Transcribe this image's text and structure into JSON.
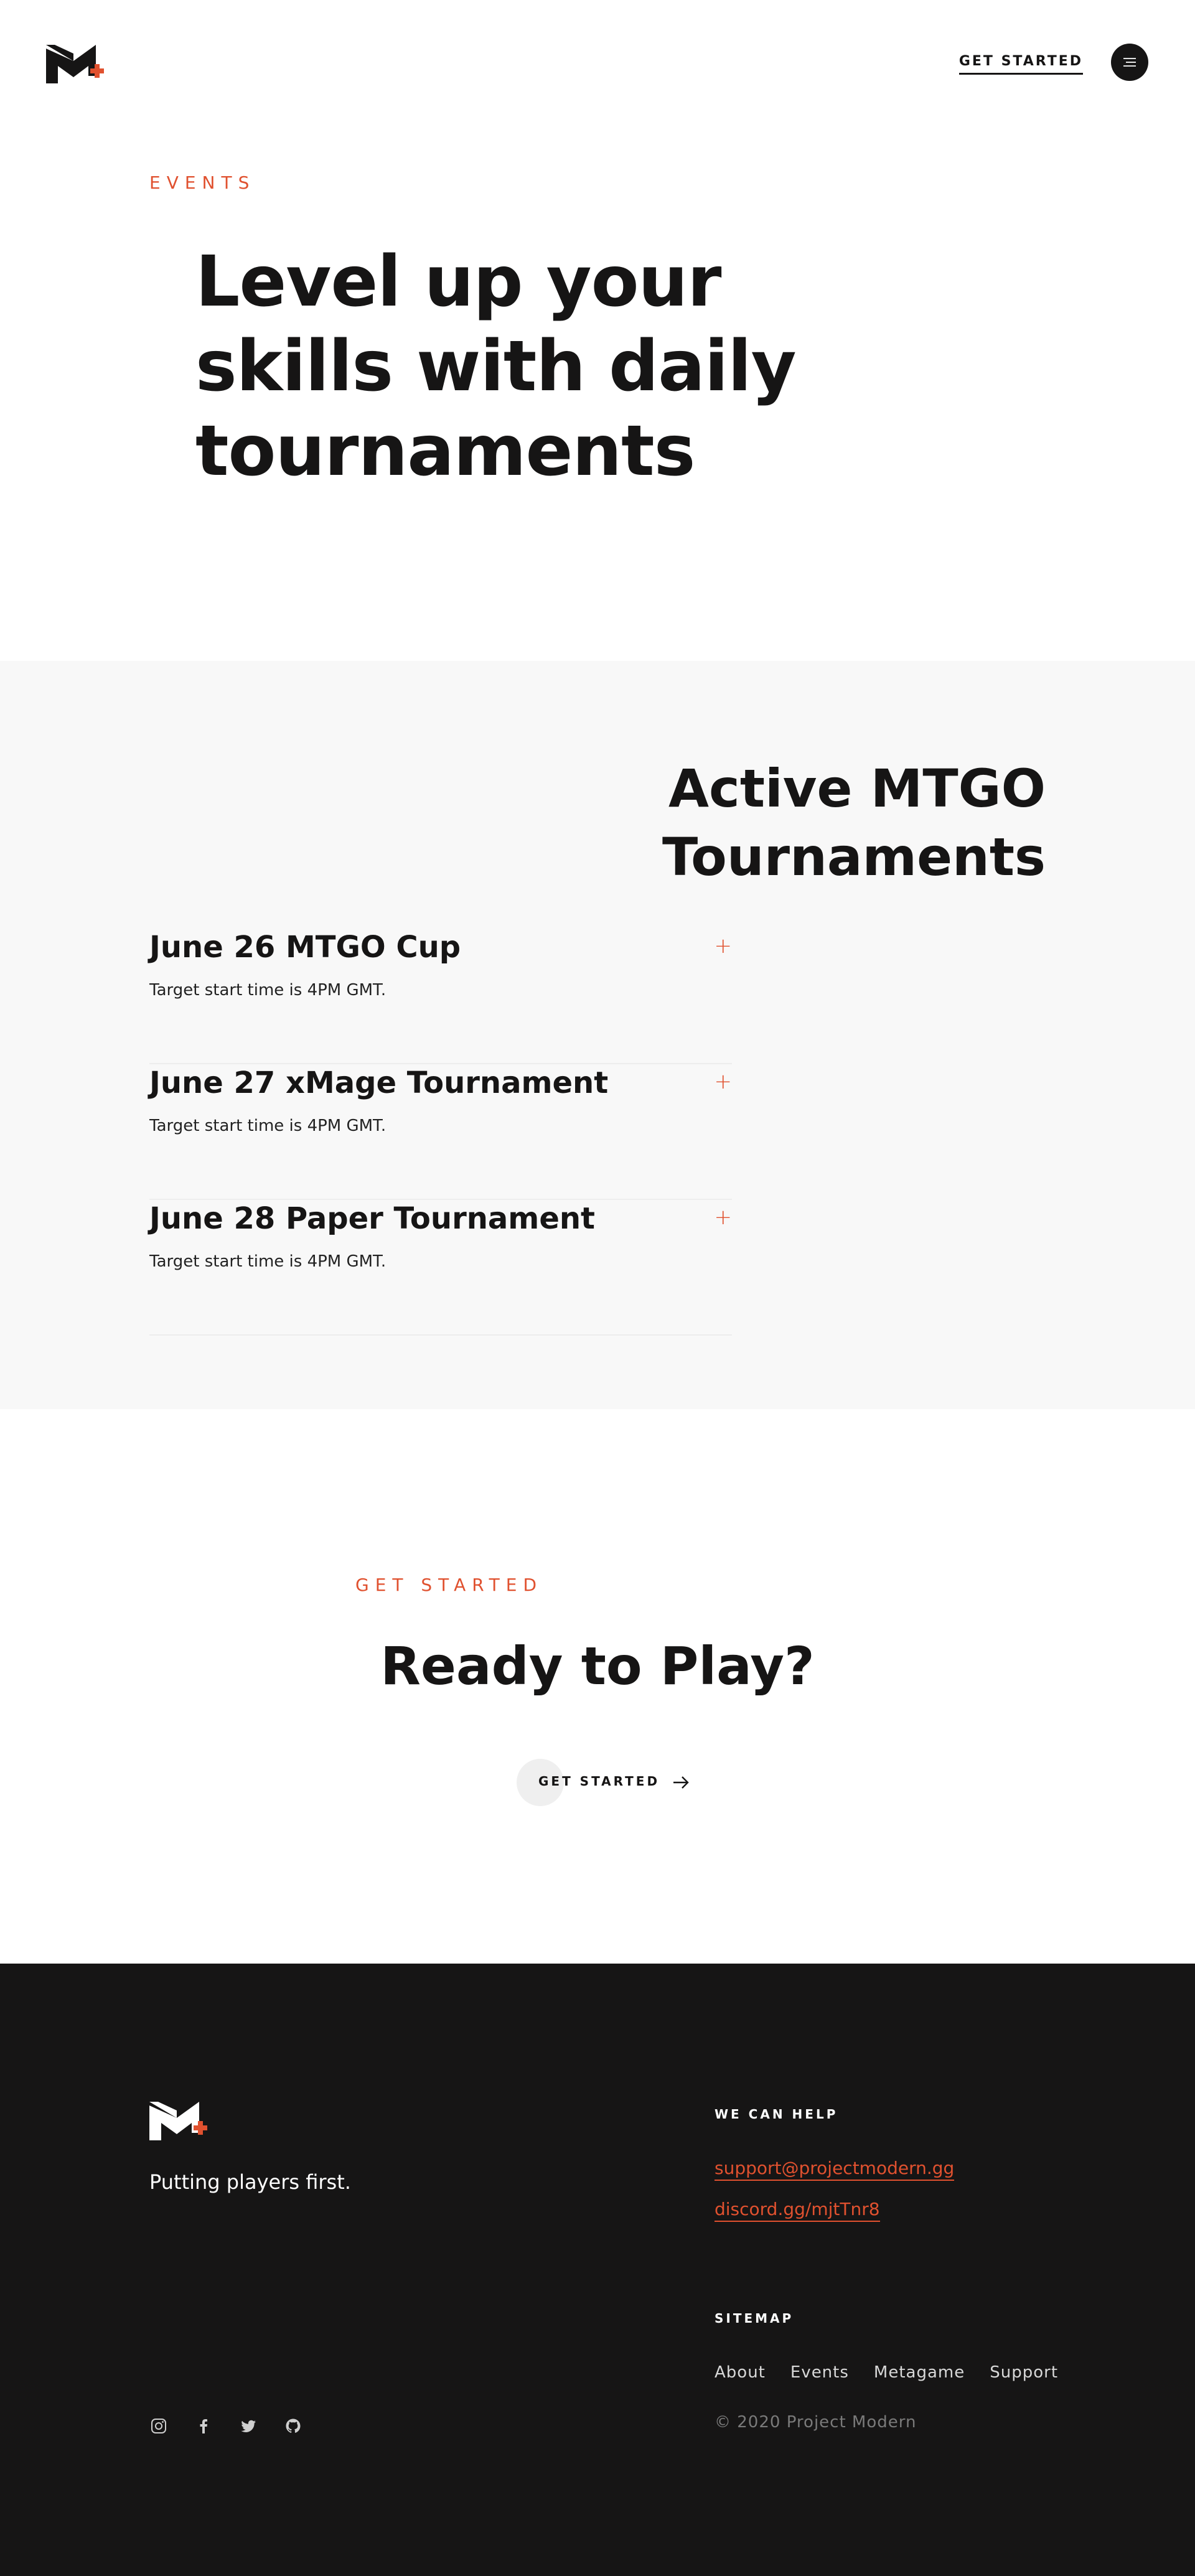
{
  "brand": {
    "accent": "#e0512f",
    "dark": "#161515",
    "logo_icon": "m-plus-logo-icon"
  },
  "header": {
    "cta_label": "GET STARTED",
    "menu_icon": "hamburger-menu-icon"
  },
  "hero": {
    "eyebrow": "EVENTS",
    "title": "Level up your skills with daily tournaments"
  },
  "events": {
    "title": "Active MTGO Tournaments",
    "items": [
      {
        "title": "June 26 MTGO Cup",
        "description": "Target start time is 4PM GMT.",
        "toggle": "+"
      },
      {
        "title": "June 27 xMage Tournament",
        "description": "Target start time is 4PM GMT.",
        "toggle": "+"
      },
      {
        "title": "June 28 Paper Tournament",
        "description": "Target start time is 4PM GMT.",
        "toggle": "+"
      }
    ]
  },
  "cta": {
    "eyebrow": "GET STARTED",
    "title": "Ready to Play?",
    "button_label": "GET STARTED",
    "button_icon": "arrow-right-icon"
  },
  "footer": {
    "tagline": "Putting players first.",
    "help_heading": "WE CAN HELP",
    "help_links": [
      "support@projectmodern.gg",
      "discord.gg/mjtTnr8"
    ],
    "sitemap_heading": "SITEMAP",
    "sitemap_links": [
      "About",
      "Events",
      "Metagame",
      "Support"
    ],
    "copyright": "© 2020 Project Modern",
    "socials": [
      "instagram-icon",
      "facebook-icon",
      "twitter-icon",
      "github-icon"
    ]
  }
}
